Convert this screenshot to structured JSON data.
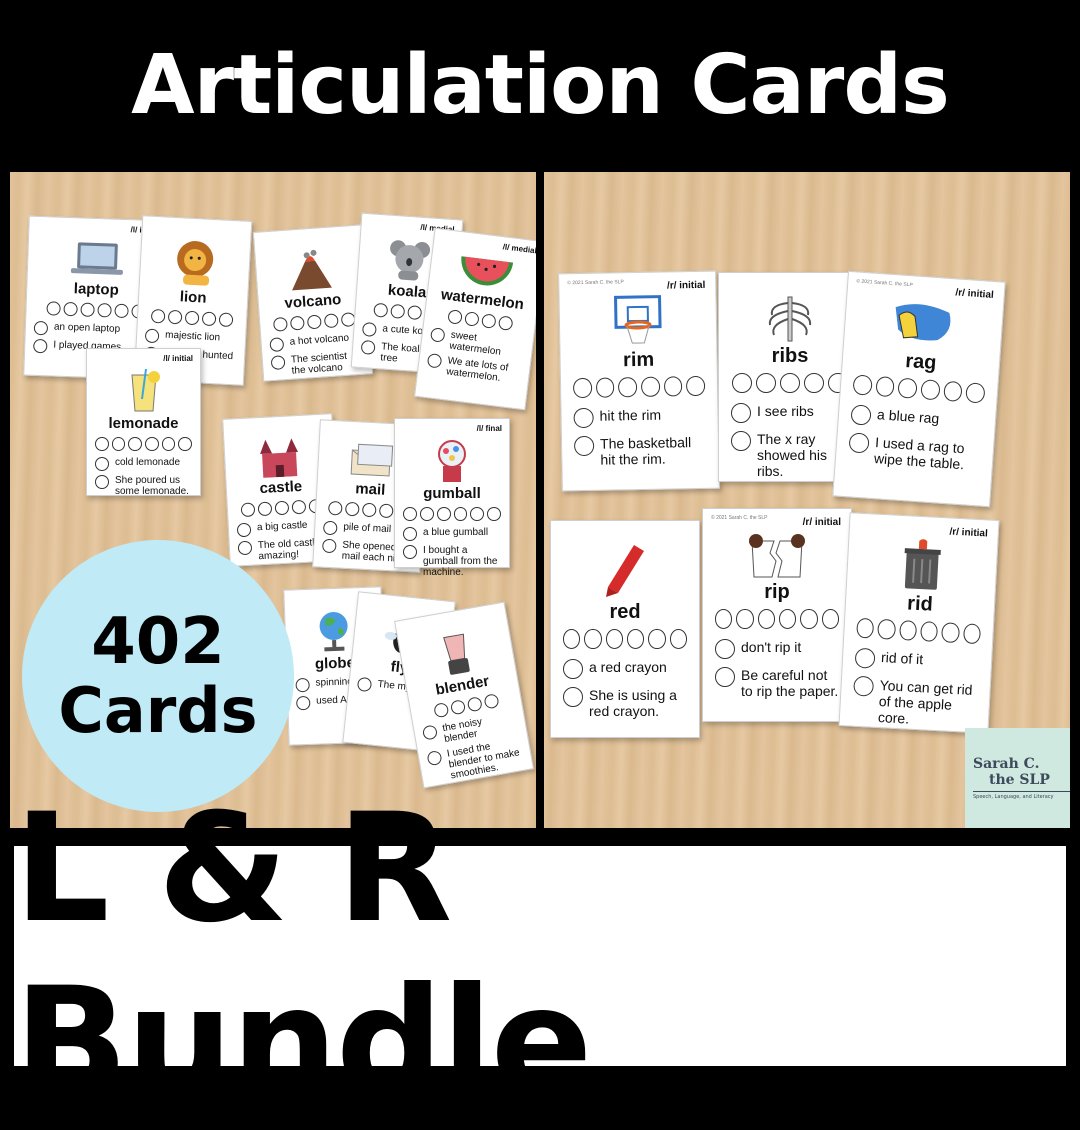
{
  "header": {
    "title": "Articulation Cards"
  },
  "badge": {
    "count": "402",
    "label": "Cards"
  },
  "footer": {
    "title": "L & R Bundle"
  },
  "logo": {
    "line1": "Sarah C.",
    "line2": "the SLP",
    "tagline": "Speech, Language, and Literacy"
  },
  "left_cards": {
    "laptop": {
      "tag": "/l/ initial",
      "word": "laptop",
      "s1": "an open laptop",
      "s2": "I played games"
    },
    "lion": {
      "tag": "",
      "word": "lion",
      "s1": "majestic lion",
      "s2": "The lion hunted for"
    },
    "volcano": {
      "tag": "",
      "word": "volcano",
      "s1": "a hot volcano",
      "s2": "The scientist the volcano"
    },
    "koala": {
      "tag": "/l/ medial",
      "word": "koala",
      "s1": "a cute koala",
      "s2": "The koala the tree"
    },
    "watermelon": {
      "tag": "/l/ medial",
      "word": "watermelon",
      "s1": "sweet watermelon",
      "s2": "We ate lots of watermelon."
    },
    "lemonade": {
      "tag": "/l/ initial",
      "word": "lemonade",
      "s1": "cold lemonade",
      "s2": "She poured us some lemonade."
    },
    "castle": {
      "tag": "",
      "word": "castle",
      "s1": "a big castle",
      "s2": "The old castle amazing!"
    },
    "mail": {
      "tag": "",
      "word": "mail",
      "s1": "pile of mail",
      "s2": "She opened mail each night"
    },
    "gumball": {
      "tag": "/l/ final",
      "word": "gumball",
      "s1": "a blue gumball",
      "s2": "I bought a gumball from the machine."
    },
    "globe": {
      "tag": "",
      "word": "globe",
      "s1": "spinning",
      "s2": "used Anta"
    },
    "fly": {
      "tag": "",
      "word": "fly",
      "s1": "",
      "s2": "The my ear."
    },
    "blender": {
      "tag": "",
      "word": "blender",
      "s1": "the noisy blender",
      "s2": "I used the blender to make smoothies."
    }
  },
  "right_cards": {
    "rim": {
      "tag": "/r/ initial",
      "copy": "© 2021 Sarah C. the SLP",
      "word": "rim",
      "s1": "hit the rim",
      "s2": "The basketball hit the rim."
    },
    "ribs": {
      "tag": "",
      "copy": "",
      "word": "ribs",
      "s1": "I see ribs",
      "s2": "The x ray showed his ribs."
    },
    "rag": {
      "tag": "/r/ initial",
      "copy": "© 2021 Sarah C. the SLP",
      "word": "rag",
      "s1": "a blue rag",
      "s2": "I used a rag to wipe the table."
    },
    "red": {
      "tag": "",
      "copy": "",
      "word": "red",
      "s1": "a red crayon",
      "s2": "She is using a red crayon."
    },
    "rip": {
      "tag": "/r/ initial",
      "copy": "© 2021 Sarah C. the SLP",
      "word": "rip",
      "s1": "don't rip it",
      "s2": "Be careful not to rip the paper."
    },
    "rid": {
      "tag": "/r/ initial",
      "copy": "",
      "word": "rid",
      "s1": "rid of it",
      "s2": "You can get rid of the apple core."
    }
  },
  "colors": {
    "badge": "#bfeaf6",
    "logo_bg": "#cfe9e0",
    "background": "#000000"
  }
}
